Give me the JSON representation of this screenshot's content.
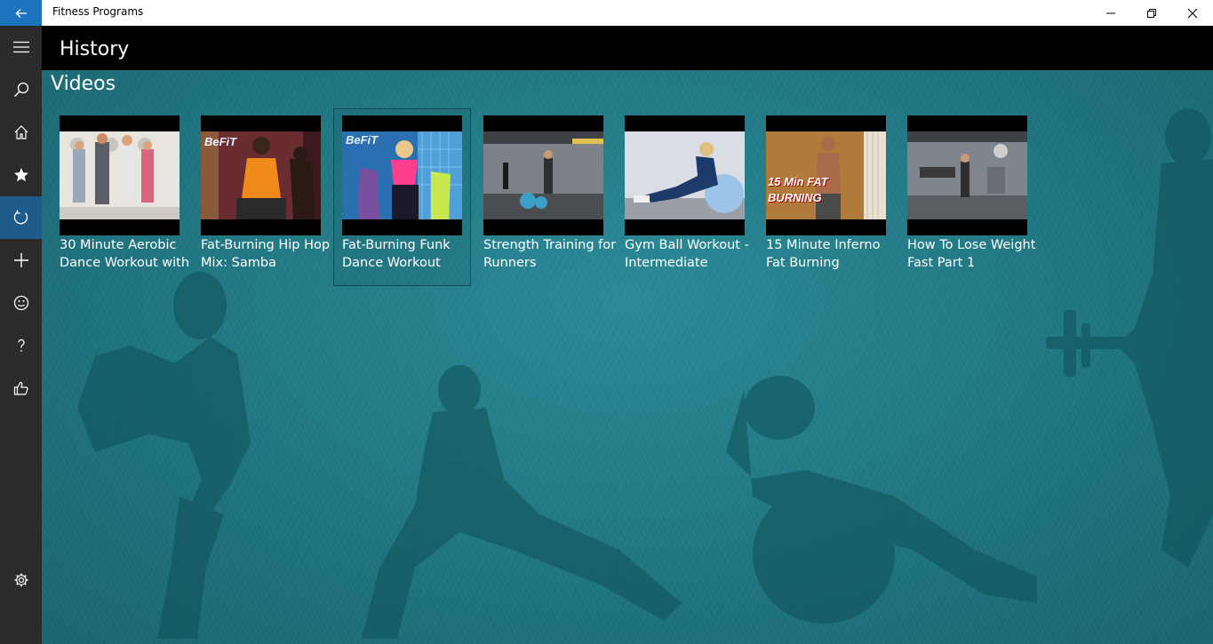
{
  "window": {
    "title": "Fitness Programs",
    "controls": [
      "minimize",
      "maximize",
      "close"
    ]
  },
  "nav": {
    "items": [
      {
        "name": "menu",
        "icon": "hamburger-icon"
      },
      {
        "name": "search",
        "icon": "search-icon"
      },
      {
        "name": "home",
        "icon": "home-icon"
      },
      {
        "name": "favorites",
        "icon": "star-icon"
      },
      {
        "name": "history",
        "icon": "refresh-icon",
        "active": true
      },
      {
        "name": "add",
        "icon": "plus-icon"
      },
      {
        "name": "feedback",
        "icon": "smiley-icon"
      },
      {
        "name": "help",
        "icon": "question-icon"
      },
      {
        "name": "rate",
        "icon": "thumbs-up-icon"
      },
      {
        "name": "settings",
        "icon": "gear-icon"
      }
    ]
  },
  "header": {
    "title": "History"
  },
  "main": {
    "section_title": "Videos",
    "videos": [
      {
        "title": "30 Minute Aerobic Dance Workout with"
      },
      {
        "title": "Fat-Burning Hip Hop Mix: Samba",
        "overlay": "BeFiT"
      },
      {
        "title": "Fat-Burning Funk Dance Workout",
        "overlay": "BeFiT",
        "focused": true
      },
      {
        "title": "Strength Training for Runners"
      },
      {
        "title": "Gym Ball Workout - Intermediate"
      },
      {
        "title": "15 Minute Inferno Fat Burning",
        "overlay": "15 Min FAT BURNING"
      },
      {
        "title": "How To Lose Weight Fast Part 1"
      }
    ]
  },
  "colors": {
    "accent": "#1e73be",
    "background_teal": "#1f7480",
    "header_bg": "#000000",
    "rail_bg": "#2b2b2b"
  }
}
